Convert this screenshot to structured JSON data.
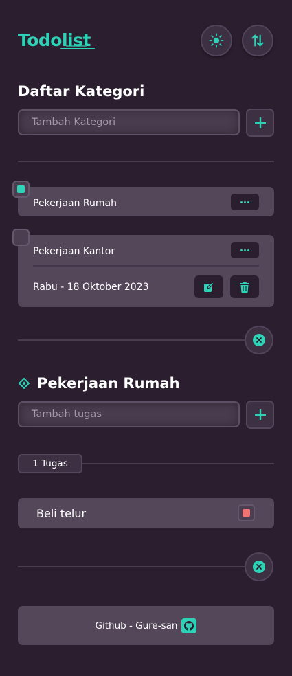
{
  "header": {
    "logo_text": "Todolist",
    "theme_toggle": "sun-icon",
    "sort_toggle": "sort-arrows-icon"
  },
  "categories": {
    "title": "Daftar Kategori",
    "input_placeholder": "Tambah Kategori",
    "items": [
      {
        "name": "Pekerjaan Rumah",
        "selected": true
      },
      {
        "name": "Pekerjaan Kantor",
        "selected": false,
        "date": "Rabu - 18 Oktober 2023"
      }
    ]
  },
  "tasks": {
    "title": "Pekerjaan Rumah",
    "input_placeholder": "Tambah tugas",
    "count_label": "1 Tugas",
    "items": [
      {
        "name": "Beli telur"
      }
    ]
  },
  "footer": {
    "label": "Github - Gure-san"
  },
  "colors": {
    "background": "#2b1f2f",
    "accent": "#2ed3b7",
    "card": "#55475a",
    "danger": "#f07272"
  }
}
